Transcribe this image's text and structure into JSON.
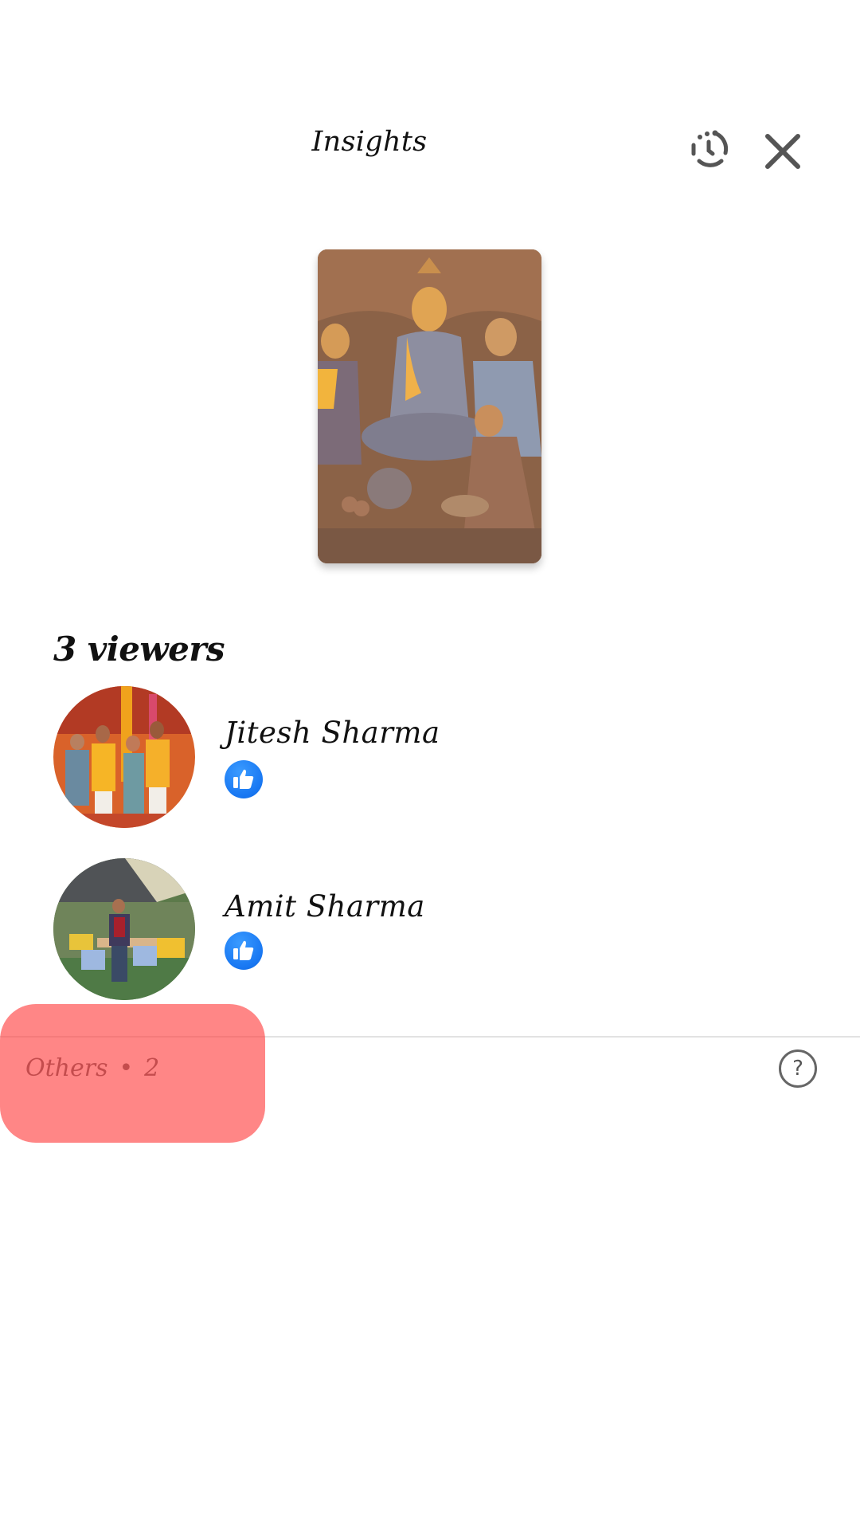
{
  "header": {
    "title": "Insights",
    "history_icon": "story-history-icon",
    "close_icon": "close-icon"
  },
  "story": {
    "thumbnail_alt": "Carved relief of seated Buddha with disciples"
  },
  "viewers": {
    "heading": "3 viewers",
    "list": [
      {
        "name": "Jitesh Sharma",
        "reaction": "like",
        "avatar_alt": "Group photo of people in saffron attire"
      },
      {
        "name": "Amit Sharma",
        "reaction": "like",
        "avatar_alt": "Man standing in an outdoor seating area"
      }
    ]
  },
  "others": {
    "label": "Others",
    "separator": "•",
    "count": "2",
    "help_icon": "question-circle-icon",
    "help_glyph": "?"
  },
  "colors": {
    "like_blue": "#1877F2",
    "highlight_red": "#FF8080",
    "icon_gray": "#555555",
    "secondary_text": "#65676B"
  }
}
